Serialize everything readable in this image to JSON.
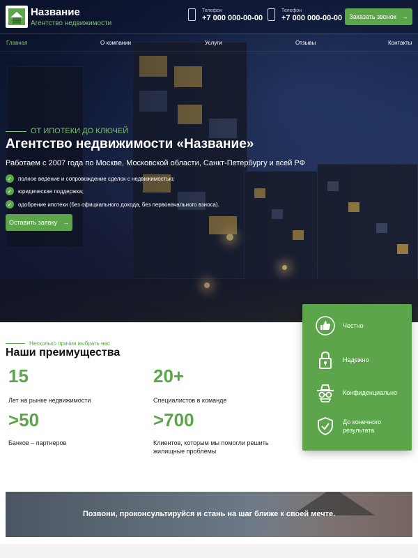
{
  "header": {
    "brand_name": "Название",
    "brand_sub": "Агентство недвижимости",
    "phone_label_1": "Телефон",
    "phone_1": "+7 000 000-00-00",
    "phone_label_2": "Телефон",
    "phone_2": "+7 000 000-00-00",
    "call_button": "Заказать звонок"
  },
  "nav": {
    "items": [
      "Главная",
      "О компании",
      "Услуги",
      "Отзывы",
      "Контакты"
    ],
    "active_index": 0
  },
  "hero": {
    "eyebrow": "ОТ ИПОТЕКИ ДО КЛЮЧЕЙ",
    "title": "Агентство недвижимости «Название»",
    "subtitle": "Работаем с 2007 года по Москве, Московской области, Санкт-Петербургу и всей РФ",
    "checks": [
      "полное ведение и сопровождение сделок с недвижимостью;",
      "юридическая поддержка;",
      "одобрение ипотеки (без официального дохода, без первоначального взноса)."
    ],
    "apply_button": "Оставить заявку"
  },
  "advantages": {
    "eyebrow": "Несколько причин выбрать нас",
    "title": "Наши преимущества",
    "stats": [
      {
        "value": "15",
        "label": "Лет на рынке недвижимости"
      },
      {
        "value": "20+",
        "label": "Специалистов в команде"
      },
      {
        "value": ">50",
        "label": "Банков – партнеров"
      },
      {
        "value": ">700",
        "label": "Клиентов, которым мы помогли решить жилищные проблемы"
      }
    ]
  },
  "features": [
    {
      "icon": "thumbs-up-icon",
      "label": "Честно"
    },
    {
      "icon": "lock-icon",
      "label": "Надежно"
    },
    {
      "icon": "spy-icon",
      "label": "Конфиденциально"
    },
    {
      "icon": "shield-check-icon",
      "label": "До конечного результата"
    }
  ],
  "banner": {
    "text": "Позвони, проконсультируйся и стань на шаг ближе к своей мечте."
  },
  "colors": {
    "accent": "#5ca54a",
    "accent_light": "#7cc36e",
    "hero_dark": "#0d1a3a"
  }
}
